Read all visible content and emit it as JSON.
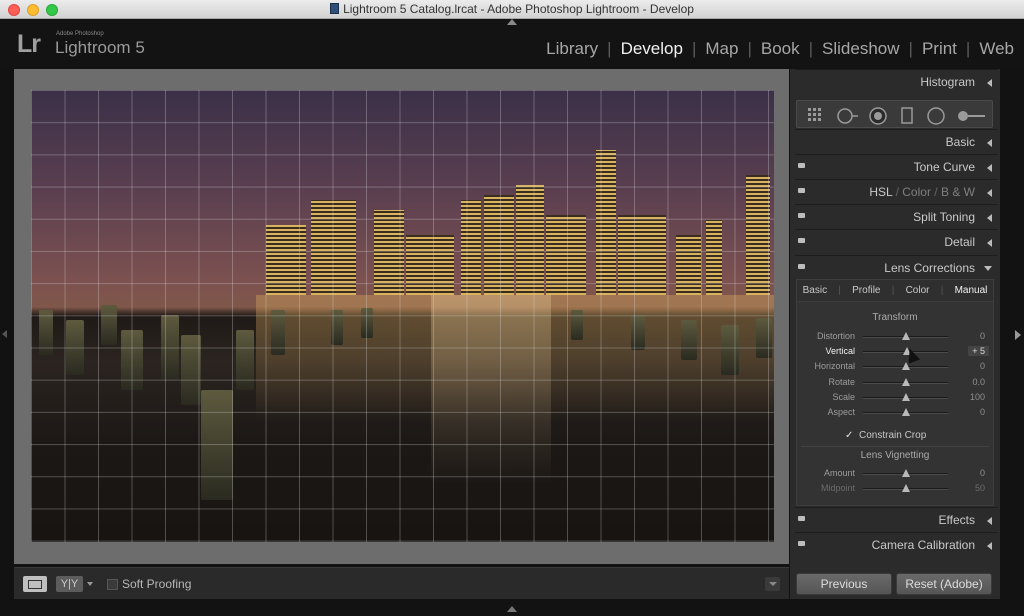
{
  "window": {
    "title": "Lightroom 5 Catalog.lrcat - Adobe Photoshop Lightroom - Develop"
  },
  "identity": {
    "logo": "Lr",
    "vendor": "Adobe Photoshop",
    "app_name": "Lightroom 5"
  },
  "modules": [
    {
      "label": "Library",
      "active": false
    },
    {
      "label": "Develop",
      "active": true
    },
    {
      "label": "Map",
      "active": false
    },
    {
      "label": "Book",
      "active": false
    },
    {
      "label": "Slideshow",
      "active": false
    },
    {
      "label": "Print",
      "active": false
    },
    {
      "label": "Web",
      "active": false
    }
  ],
  "toolbar": {
    "view_mode_icon": "loupe-view-icon",
    "compare_label": "Y|Y",
    "soft_proofing_label": "Soft Proofing",
    "soft_proofing_checked": false
  },
  "panels": {
    "histogram": "Histogram",
    "basic": "Basic",
    "tone_curve": "Tone Curve",
    "hsl": {
      "hsl": "HSL",
      "color": "Color",
      "bw": "B & W",
      "sep": "/"
    },
    "split_toning": "Split Toning",
    "detail": "Detail",
    "lens_corrections": "Lens Corrections",
    "effects": "Effects",
    "camera_calibration": "Camera Calibration"
  },
  "tools": [
    "crop-overlay-icon",
    "spot-removal-icon",
    "red-eye-icon",
    "graduated-filter-icon",
    "radial-filter-icon",
    "adjustment-brush-icon"
  ],
  "lens": {
    "tabs": [
      {
        "label": "Basic",
        "active": false
      },
      {
        "label": "Profile",
        "active": false
      },
      {
        "label": "Color",
        "active": false
      },
      {
        "label": "Manual",
        "active": true
      }
    ],
    "transform_title": "Transform",
    "transform": [
      {
        "label": "Distortion",
        "value": "0",
        "pos": 0.5
      },
      {
        "label": "Vertical",
        "value": "+ 5",
        "pos": 0.52,
        "active": true
      },
      {
        "label": "Horizontal",
        "value": "0",
        "pos": 0.5
      },
      {
        "label": "Rotate",
        "value": "0.0",
        "pos": 0.5
      },
      {
        "label": "Scale",
        "value": "100",
        "pos": 0.5
      },
      {
        "label": "Aspect",
        "value": "0",
        "pos": 0.5
      }
    ],
    "constrain_crop_label": "Constrain Crop",
    "constrain_crop_checked": true,
    "vignetting_title": "Lens Vignetting",
    "vignetting": [
      {
        "label": "Amount",
        "value": "0",
        "pos": 0.5
      },
      {
        "label": "Midpoint",
        "value": "50",
        "pos": 0.5,
        "dim": true
      }
    ]
  },
  "buttons": {
    "previous": "Previous",
    "reset": "Reset (Adobe)"
  }
}
